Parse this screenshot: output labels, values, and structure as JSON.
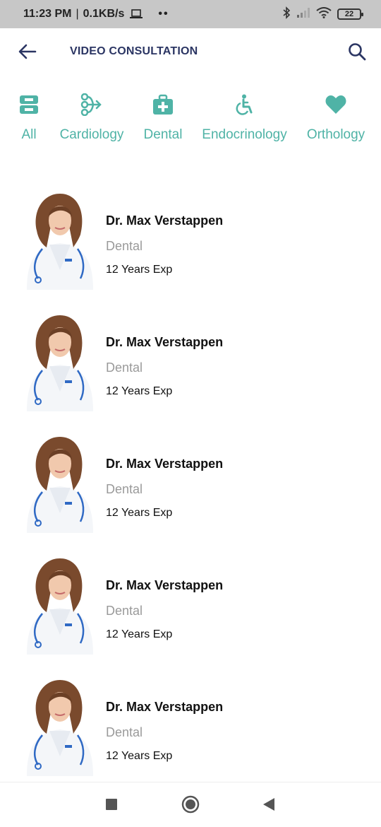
{
  "status_bar": {
    "time": "11:23 PM",
    "separator": "|",
    "network_speed": "0.1KB/s",
    "dots": "••",
    "battery": "22",
    "icons": [
      "laptop-icon",
      "bluetooth-icon",
      "signal-icon",
      "wifi-icon",
      "battery-icon"
    ]
  },
  "header": {
    "title": "VIDEO CONSULTATION",
    "back_icon": "arrow-left-icon",
    "search_icon": "search-icon"
  },
  "categories": [
    {
      "label": "All",
      "icon": "inbox-tray-icon"
    },
    {
      "label": "Cardiology",
      "icon": "branch-arrows-icon"
    },
    {
      "label": "Dental",
      "icon": "medical-kit-icon"
    },
    {
      "label": "Endocrinology",
      "icon": "wheelchair-icon"
    },
    {
      "label": "Orthology",
      "icon": "heart-icon"
    }
  ],
  "doctors": [
    {
      "name": "Dr. Max Verstappen",
      "specialty": "Dental",
      "experience": "12 Years Exp"
    },
    {
      "name": "Dr. Max Verstappen",
      "specialty": "Dental",
      "experience": "12 Years Exp"
    },
    {
      "name": "Dr. Max Verstappen",
      "specialty": "Dental",
      "experience": "12 Years Exp"
    },
    {
      "name": "Dr. Max Verstappen",
      "specialty": "Dental",
      "experience": "12 Years Exp"
    },
    {
      "name": "Dr. Max Verstappen",
      "specialty": "Dental",
      "experience": "12 Years Exp"
    }
  ],
  "nav_bar": {
    "buttons": [
      "recents-square-icon",
      "home-circle-icon",
      "back-triangle-icon"
    ]
  },
  "colors": {
    "accent": "#4fb3a6",
    "title": "#2b3563",
    "status_bar_bg": "#c7c7c7",
    "muted_text": "#9a9a9a"
  }
}
